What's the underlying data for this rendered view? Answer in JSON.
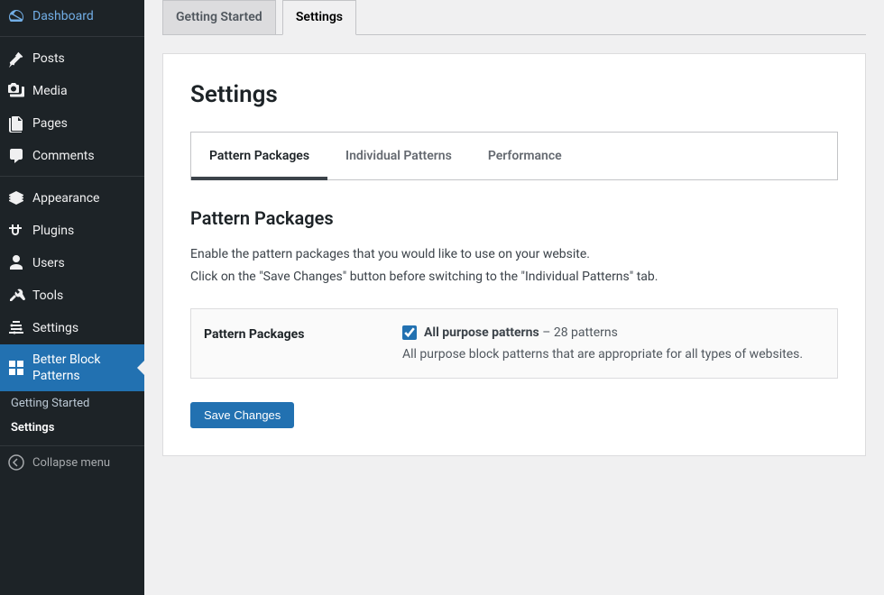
{
  "sidebar": {
    "items": [
      {
        "label": "Dashboard",
        "icon": "dashboard"
      },
      {
        "label": "Posts",
        "icon": "pin"
      },
      {
        "label": "Media",
        "icon": "media"
      },
      {
        "label": "Pages",
        "icon": "pages"
      },
      {
        "label": "Comments",
        "icon": "comments"
      },
      {
        "label": "Appearance",
        "icon": "appearance"
      },
      {
        "label": "Plugins",
        "icon": "plugins"
      },
      {
        "label": "Users",
        "icon": "users"
      },
      {
        "label": "Tools",
        "icon": "tools"
      },
      {
        "label": "Settings",
        "icon": "settings"
      },
      {
        "label": "Better Block Patterns",
        "icon": "bbp"
      }
    ],
    "subitems": [
      {
        "label": "Getting Started"
      },
      {
        "label": "Settings"
      }
    ],
    "collapse_label": "Collapse menu"
  },
  "top_tabs": [
    {
      "label": "Getting Started"
    },
    {
      "label": "Settings"
    }
  ],
  "panel": {
    "title": "Settings",
    "inner_tabs": [
      {
        "label": "Pattern Packages"
      },
      {
        "label": "Individual Patterns"
      },
      {
        "label": "Performance"
      }
    ],
    "section_heading": "Pattern Packages",
    "section_desc_line1": "Enable the pattern packages that you would like to use on your website.",
    "section_desc_line2": "Click on the \"Save Changes\" button before switching to the \"Individual Patterns\" tab.",
    "form_label": "Pattern Packages",
    "package": {
      "name": "All purpose patterns",
      "count_text": " – 28 patterns",
      "description": "All purpose block patterns that are appropriate for all types of websites."
    },
    "save_label": "Save Changes"
  }
}
